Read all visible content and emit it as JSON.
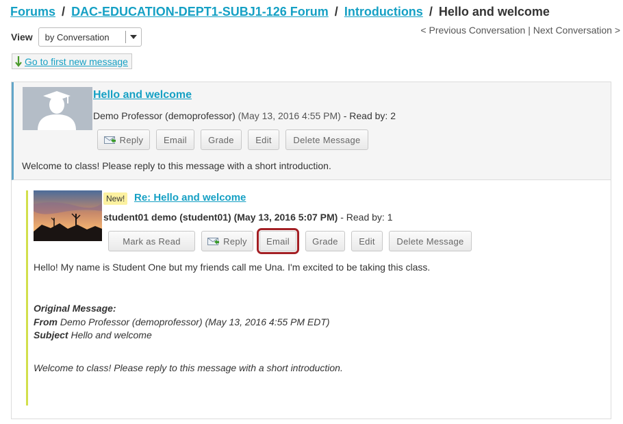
{
  "breadcrumb": {
    "forums": "Forums",
    "forum": "DAC-EDUCATION-DEPT1-SUBJ1-126 Forum",
    "topic": "Introductions",
    "current": "Hello and welcome",
    "separator": "/"
  },
  "view": {
    "label": "View",
    "selected": "by Conversation"
  },
  "conversation_nav": {
    "previous": "< Previous Conversation",
    "separator": "|",
    "next": "Next Conversation >"
  },
  "first_new": {
    "label": "Go to first new message"
  },
  "messages": {
    "top": {
      "title": "Hello and welcome",
      "author": "Demo Professor (demoprofessor)",
      "date": "(May 13, 2016 4:55 PM)",
      "read_by": "- Read by: 2",
      "buttons": [
        "Reply",
        "Email",
        "Grade",
        "Edit",
        "Delete Message"
      ],
      "body": "Welcome to class! Please reply to this message with a short introduction."
    },
    "reply": {
      "badge": "New!",
      "title": "Re: Hello and welcome",
      "author": "student01 demo (student01)",
      "date": "(May 13, 2016 5:07 PM)",
      "read_by": "- Read by: 1",
      "buttons": [
        "Mark as Read",
        "Reply",
        "Email",
        "Grade",
        "Edit",
        "Delete Message"
      ],
      "body": "Hello! My name is Student One but my friends call me Una. I'm excited to be taking this class.",
      "original": {
        "heading": "Original Message:",
        "from_label": "From",
        "from_value": "Demo Professor (demoprofessor) (May 13, 2016 4:55 PM EDT)",
        "subject_label": "Subject",
        "subject_value": "Hello and welcome",
        "body": "Welcome to class! Please reply to this message with a short introduction."
      }
    }
  },
  "colors": {
    "link": "#15a0c4",
    "highlight_ring": "#a31f24",
    "top_border": "#62a6c9",
    "reply_border": "#d2df4b",
    "new_badge": "#fcf1a0"
  },
  "icons": {
    "reply": "reply-icon",
    "first_new": "down-arrow-icon"
  }
}
